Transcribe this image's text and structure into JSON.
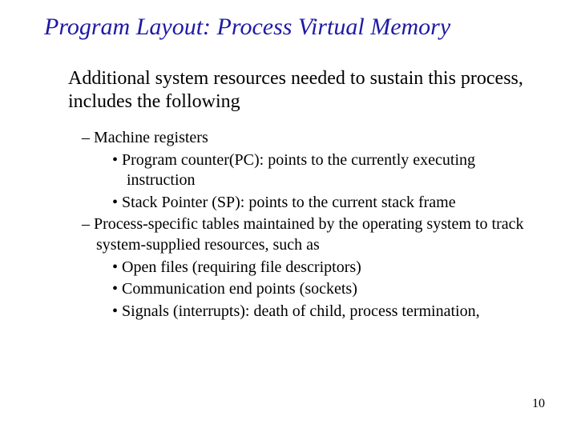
{
  "title": "Program Layout: Process Virtual Memory",
  "intro": "Additional system resources needed to sustain this process, includes the following",
  "bullets": {
    "b1": "Machine registers",
    "b1a": "Program counter(PC): points to the currently executing instruction",
    "b1b": "Stack Pointer (SP): points to the current stack frame",
    "b2": "Process-specific tables maintained by the operating system to track system-supplied resources, such as",
    "b2a": "Open files (requiring file descriptors)",
    "b2b": "Communication end points (sockets)",
    "b2c": "Signals (interrupts): death of child, process termination,"
  },
  "page_number": "10"
}
